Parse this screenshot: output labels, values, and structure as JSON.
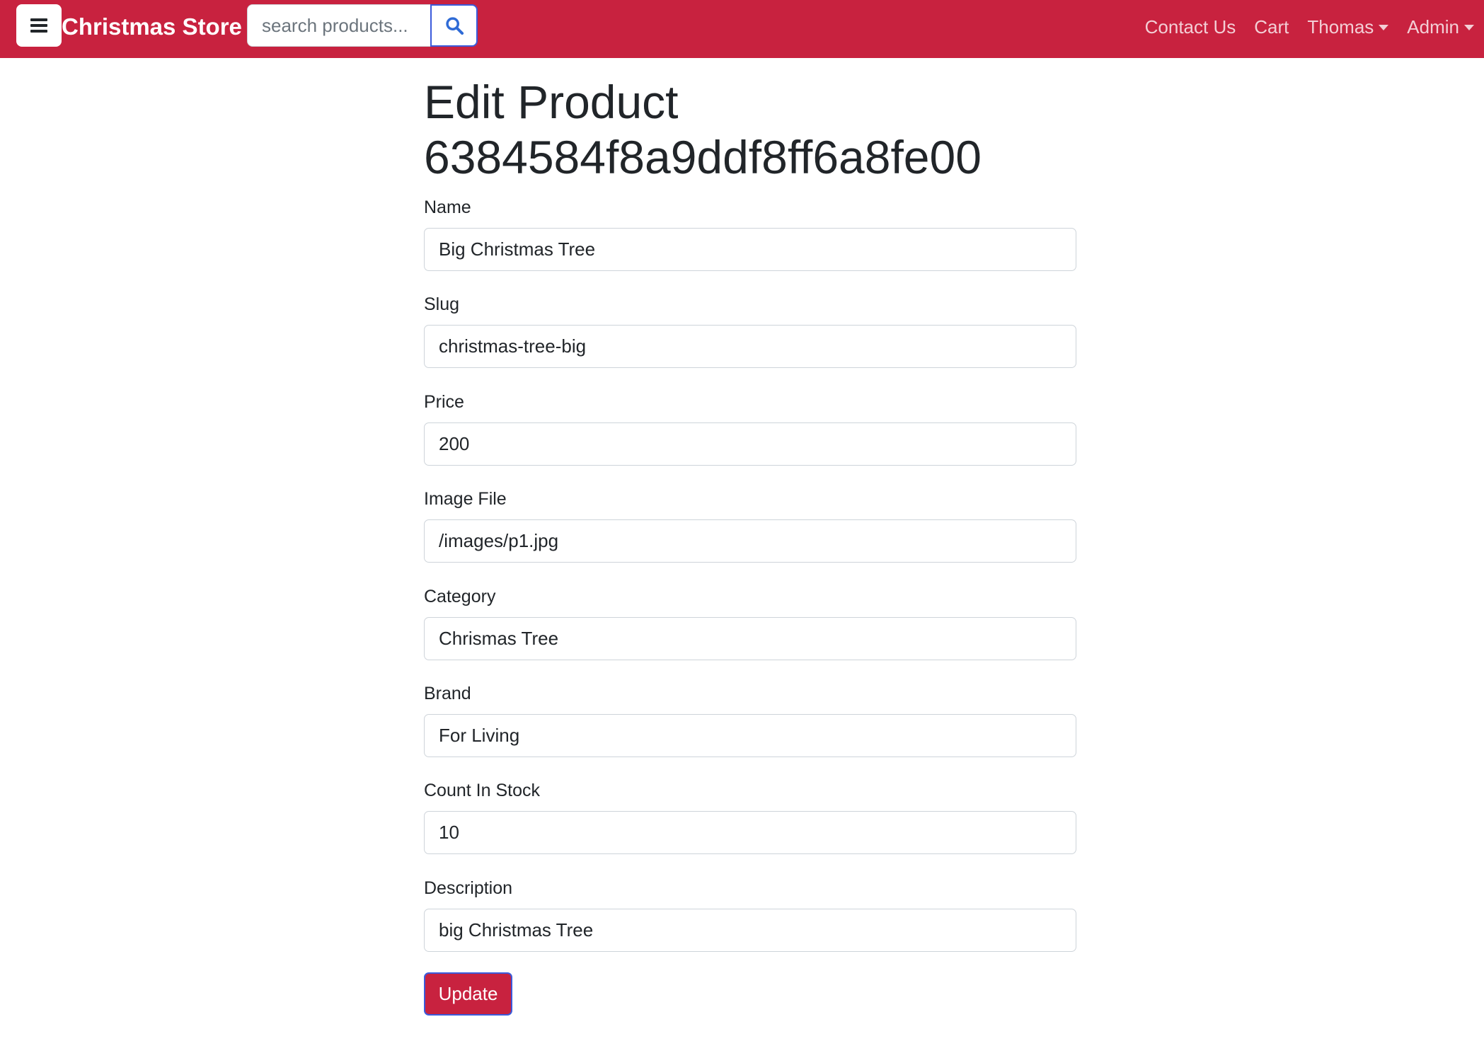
{
  "navbar": {
    "brand": "Christmas Store",
    "search_placeholder": "search products...",
    "links": {
      "contact": "Contact Us",
      "cart": "Cart",
      "user": "Thomas",
      "admin": "Admin"
    },
    "icons": {
      "menu": "hamburger-menu-icon",
      "search": "search-icon",
      "dropdown": "caret-down-icon"
    },
    "colors": {
      "background": "#c8223f",
      "search_button_border": "#3b5bdb",
      "search_icon": "#2f6bd6"
    }
  },
  "page": {
    "title_line1": "Edit Product",
    "title_line2": "6384584f8a9ddf8ff6a8fe00"
  },
  "form": {
    "name": {
      "label": "Name",
      "value": "Big Christmas Tree"
    },
    "slug": {
      "label": "Slug",
      "value": "christmas-tree-big"
    },
    "price": {
      "label": "Price",
      "value": "200"
    },
    "image": {
      "label": "Image File",
      "value": "/images/p1.jpg"
    },
    "category": {
      "label": "Category",
      "value": "Chrismas Tree"
    },
    "brand": {
      "label": "Brand",
      "value": "For Living"
    },
    "count": {
      "label": "Count In Stock",
      "value": "10"
    },
    "description": {
      "label": "Description",
      "value": "big Christmas Tree"
    },
    "submit_label": "Update"
  }
}
